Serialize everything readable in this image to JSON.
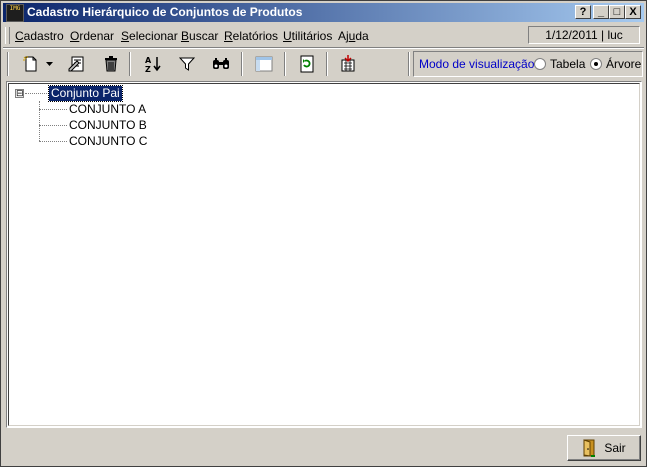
{
  "window": {
    "title": "Cadastro Hierárquico de Conjuntos de Produtos",
    "app_icon_text": "IMG",
    "controls": {
      "help": "?",
      "minimize": "_",
      "maximize": "□",
      "close": "X"
    }
  },
  "menu": {
    "items": [
      {
        "pre": "",
        "u": "C",
        "post": "adastro"
      },
      {
        "pre": "",
        "u": "O",
        "post": "rdenar"
      },
      {
        "pre": "",
        "u": "S",
        "post": "elecionar"
      },
      {
        "pre": "",
        "u": "B",
        "post": "uscar"
      },
      {
        "pre": "",
        "u": "R",
        "post": "elatórios"
      },
      {
        "pre": "",
        "u": "U",
        "post": "tilitários"
      },
      {
        "pre": "Aj",
        "u": "u",
        "post": "da"
      }
    ],
    "status": "1/12/2011 | luc"
  },
  "toolbar": {
    "icons": [
      "new-icon",
      "dropdown-arrow-icon",
      "edit-icon",
      "delete-icon",
      "sort-az-icon",
      "filter-icon",
      "find-icon",
      "layout-icon",
      "refresh-icon",
      "export-icon"
    ],
    "view_mode_label": "Modo de visualização:",
    "view_options": [
      {
        "label": "Tabela",
        "selected": false
      },
      {
        "label": "Árvore",
        "selected": true
      }
    ]
  },
  "tree": {
    "root": "Conjunto Pai",
    "expander": "⊟",
    "children": [
      "CONJUNTO A",
      "CONJUNTO B",
      "CONJUNTO C"
    ]
  },
  "footer": {
    "exit_label": "Sair"
  },
  "colors": {
    "title_start": "#0a246a",
    "title_end": "#a6caf0",
    "selection": "#0a246a",
    "view_label": "#0000c8"
  }
}
